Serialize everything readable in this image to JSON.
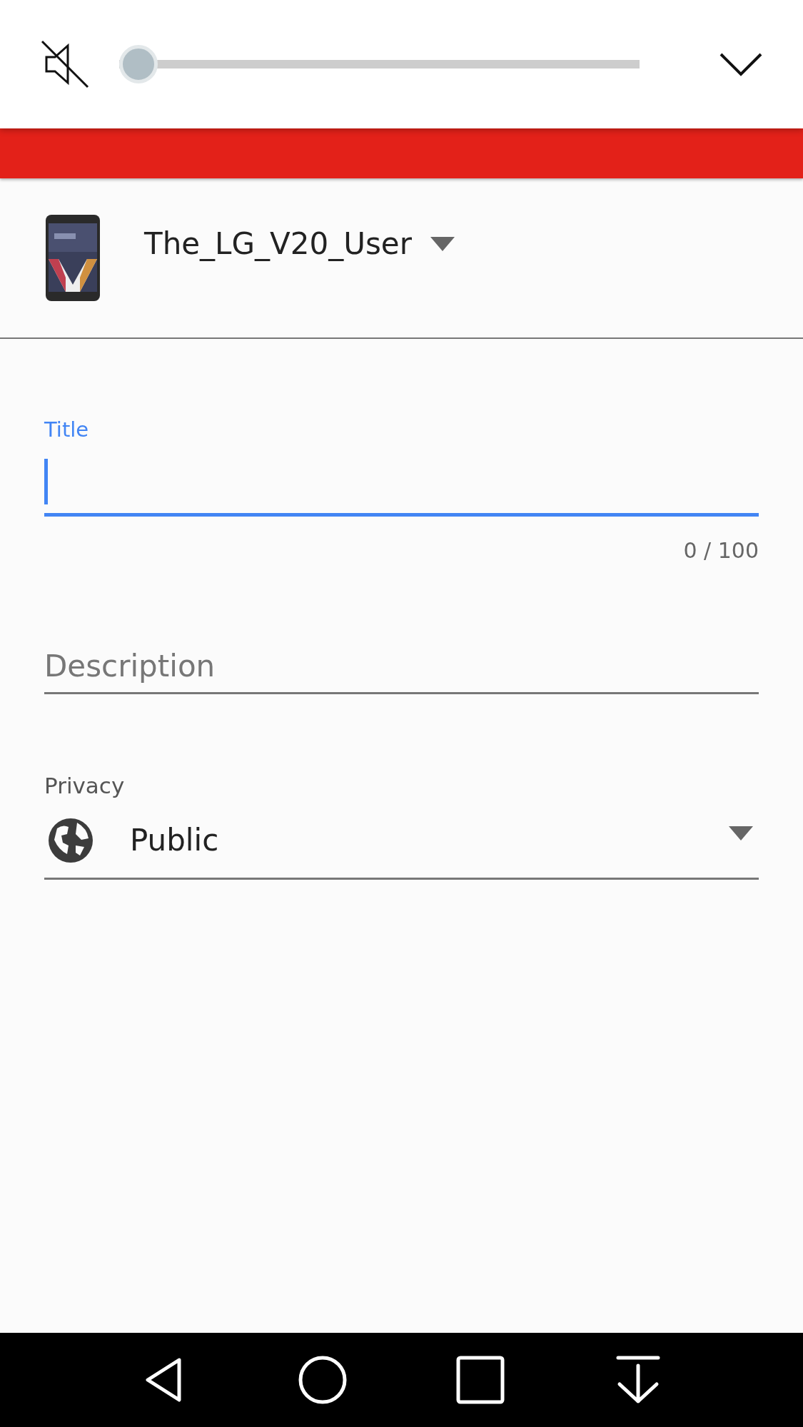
{
  "volume_panel": {
    "muted": true,
    "level": 0
  },
  "account": {
    "name": "The_LG_V20_User"
  },
  "form": {
    "title": {
      "label": "Title",
      "focused": true,
      "counter": "0 / 100"
    },
    "description": {
      "placeholder": "Description"
    },
    "privacy": {
      "label": "Privacy",
      "value": "Public"
    }
  },
  "nav_bar": [
    {
      "kind": "back"
    },
    {
      "kind": "home"
    },
    {
      "kind": "recents"
    },
    {
      "kind": "hide"
    }
  ]
}
